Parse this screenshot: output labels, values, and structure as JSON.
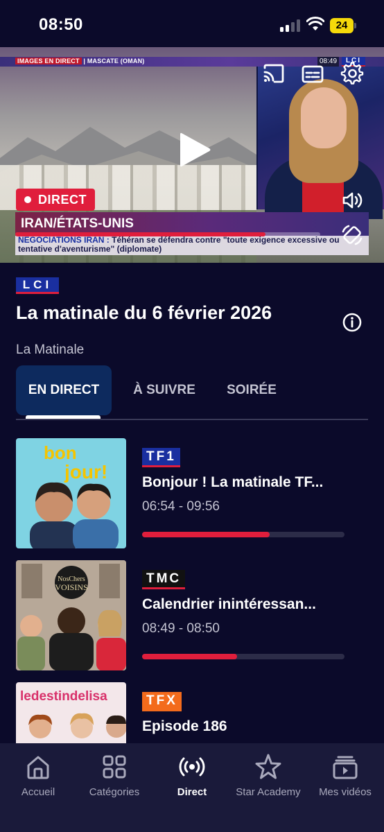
{
  "status_bar": {
    "time": "08:50",
    "battery": "24"
  },
  "player": {
    "broadcast_tag": "IMAGES EN DIRECT",
    "broadcast_location": "MASCATE (OMAN)",
    "broadcast_clock": "08:49",
    "broadcast_logo": "LCI",
    "live_label": "DIRECT",
    "lower_title": "IRAN/ÉTATS-UNIS",
    "ticker_highlight": "NÉGOCIATIONS IRAN :",
    "ticker_text": "Téhéran se défendra contre \"toute exigence excessive ou tentative d'aventurisme\" (diplomate)",
    "progress": 0.82
  },
  "program": {
    "channel": "LCI",
    "title": "La matinale du 6 février 2026",
    "subtitle": "La Matinale"
  },
  "tabs": [
    {
      "label": "EN DIRECT",
      "active": true
    },
    {
      "label": "À SUIVRE",
      "active": false
    },
    {
      "label": "SOIRÉE",
      "active": false
    }
  ],
  "items": [
    {
      "channel": "TF1",
      "title": "Bonjour ! La matinale TF...",
      "time": "06:54 - 09:56",
      "progress": 0.63,
      "thumb_text": "bon jour !"
    },
    {
      "channel": "TMC",
      "title": "Calendrier inintéressan...",
      "time": "08:49 - 08:50",
      "progress": 0.47,
      "thumb_text": "Nos Chers Voisins"
    },
    {
      "channel": "TFX",
      "title": "Episode 186",
      "time": "",
      "progress": 0,
      "thumb_text": "ledestindelisa"
    }
  ],
  "nav": [
    {
      "label": "Accueil",
      "icon": "home-icon",
      "active": false
    },
    {
      "label": "Catégories",
      "icon": "grid-icon",
      "active": false
    },
    {
      "label": "Direct",
      "icon": "broadcast-icon",
      "active": true
    },
    {
      "label": "Star Academy",
      "icon": "star-icon",
      "active": false
    },
    {
      "label": "Mes vidéos",
      "icon": "video-library-icon",
      "active": false
    }
  ],
  "colors": {
    "background": "#0b0a2a",
    "accent": "#e01e3c",
    "tab_active": "#0d2a5e",
    "nav_bg": "#1a1a3a"
  }
}
